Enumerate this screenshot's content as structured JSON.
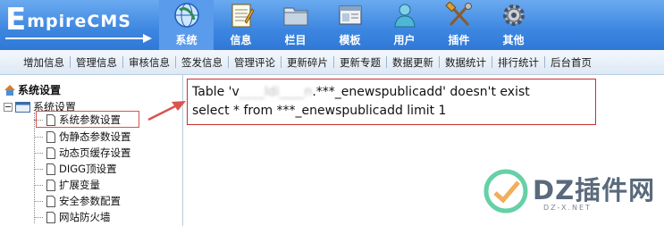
{
  "logo": {
    "first": "E",
    "rest": "mpireCMS"
  },
  "nav": [
    {
      "label": "系统",
      "icon": "globe-icon",
      "active": true
    },
    {
      "label": "信息",
      "icon": "notepad-icon"
    },
    {
      "label": "栏目",
      "icon": "folder-icon"
    },
    {
      "label": "模板",
      "icon": "template-icon"
    },
    {
      "label": "用户",
      "icon": "user-icon"
    },
    {
      "label": "插件",
      "icon": "tools-icon"
    },
    {
      "label": "其他",
      "icon": "gear-icon"
    }
  ],
  "toolbar": [
    "增加信息",
    "管理信息",
    "审核信息",
    "签发信息",
    "管理评论",
    "更新碎片",
    "更新专题",
    "数据更新",
    "数据统计",
    "排行统计",
    "后台首页"
  ],
  "sidebar": {
    "title": "系统设置",
    "root": "系统设置",
    "items": [
      {
        "label": "系统参数设置"
      },
      {
        "label": "伪静态参数设置"
      },
      {
        "label": "动态页缓存设置"
      },
      {
        "label": "DIGG顶设置"
      },
      {
        "label": "扩展变量"
      },
      {
        "label": "安全参数配置"
      },
      {
        "label": "网站防火墙"
      }
    ]
  },
  "error": {
    "line1_prefix": "Table 'v",
    "line1_blurred": "____ldi____n",
    "line1_suffix": ".***_enewspublicadd' doesn't exist",
    "line2": "select * from ***_enewspublicadd limit 1"
  },
  "watermark": {
    "text": "DZ插件网",
    "sub": "DZ-X.NET"
  },
  "colors": {
    "header_bg": "#3d86e0",
    "nav_active": "#5b9bec",
    "annotation_red": "#d9534f"
  }
}
